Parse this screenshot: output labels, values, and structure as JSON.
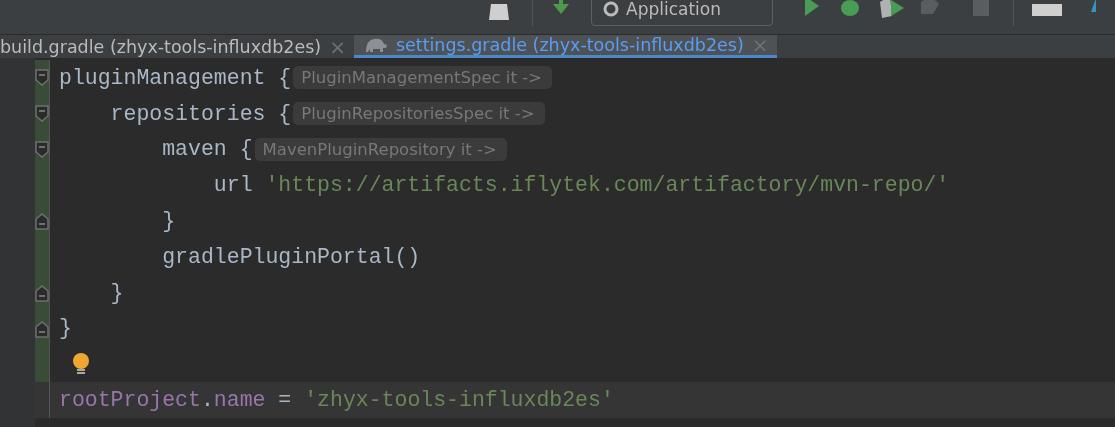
{
  "toolbar": {
    "run_config": "Application"
  },
  "tabs": [
    {
      "label": "build.gradle (zhyx-tools-influxdb2es)",
      "selected": false,
      "icon": false
    },
    {
      "label": "settings.gradle (zhyx-tools-influxdb2es)",
      "selected": true,
      "icon": true
    }
  ],
  "close_glyph": "×",
  "lines": [
    {
      "kind": "code",
      "fold": {
        "kind": "start"
      },
      "changed": true,
      "tokens": [
        {
          "kind": "plain",
          "text": "pluginManagement {"
        },
        {
          "kind": "hint",
          "text": "PluginManagementSpec it ->"
        }
      ]
    },
    {
      "kind": "code",
      "fold": {
        "kind": "start"
      },
      "changed": true,
      "tokens": [
        {
          "kind": "plain",
          "text": "    repositories {"
        },
        {
          "kind": "hint",
          "text": "PluginRepositoriesSpec it ->"
        }
      ]
    },
    {
      "kind": "code",
      "fold": {
        "kind": "start"
      },
      "changed": true,
      "tokens": [
        {
          "kind": "plain",
          "text": "        maven {"
        },
        {
          "kind": "hint",
          "text": "MavenPluginRepository it ->"
        }
      ]
    },
    {
      "kind": "code",
      "changed": true,
      "tokens": [
        {
          "kind": "plain",
          "text": "            url "
        },
        {
          "kind": "string",
          "text": "'https://artifacts.iflytek.com/artifactory/mvn-repo/'"
        }
      ]
    },
    {
      "kind": "code",
      "fold": {
        "kind": "end"
      },
      "changed": true,
      "tokens": [
        {
          "kind": "plain",
          "text": "        }"
        }
      ]
    },
    {
      "kind": "code",
      "changed": true,
      "tokens": [
        {
          "kind": "plain",
          "text": "        gradlePluginPortal()"
        }
      ]
    },
    {
      "kind": "code",
      "fold": {
        "kind": "end"
      },
      "changed": true,
      "tokens": [
        {
          "kind": "plain",
          "text": "    }"
        }
      ]
    },
    {
      "kind": "code",
      "fold": {
        "kind": "end"
      },
      "changed": true,
      "tokens": [
        {
          "kind": "plain",
          "text": "}"
        }
      ]
    },
    {
      "kind": "bulb",
      "changed": true
    },
    {
      "kind": "current",
      "changed": false,
      "tokens": [
        {
          "kind": "property",
          "text": "rootProject"
        },
        {
          "kind": "plain",
          "text": "."
        },
        {
          "kind": "property",
          "text": "name"
        },
        {
          "kind": "plain",
          "text": " = "
        },
        {
          "kind": "string",
          "text": "'zhyx-tools-influxdb2es'"
        }
      ]
    }
  ]
}
